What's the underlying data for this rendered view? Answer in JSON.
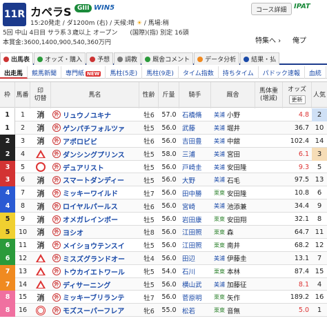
{
  "race": {
    "number": "11R",
    "name": "カペラS",
    "grade": "GIII",
    "win5": "WIN5",
    "info_line1": "15:20発走 / ダ1200m (右) / 天候:晴",
    "info_track": "/ 馬場:稍",
    "info_line2": "5回 中山 4日目 サラ系３歳以上 オープン　　(国際)(指) 別定 16頭",
    "info_line3": "本賞金:3600,1400,900,540,360万円"
  },
  "topbar": {
    "course_detail": "コース詳細",
    "ipat": "IPAT",
    "feature": "特集へ",
    "cancel": "俺プ"
  },
  "tabs": [
    "出馬表",
    "オッズ・購入",
    "予想",
    "調教",
    "厩舎コメント",
    "データ分析",
    "結果・払"
  ],
  "subtabs": [
    "出走馬",
    "競馬新聞",
    "専門紙",
    "馬柱(5走)",
    "馬柱(9走)",
    "タイム指数",
    "持ちタイム",
    "パドック速報",
    "血統"
  ],
  "new_badge": "NEW",
  "headers": {
    "waku": "枠",
    "umaban": "馬番",
    "mark": "印",
    "mark2": "切替",
    "name": "馬名",
    "sexage": "性齢",
    "weight": "斤量",
    "jockey": "騎手",
    "trainer": "厩舎",
    "body_weight": "馬体重",
    "body_diff": "(増減)",
    "odds": "オッズ",
    "refresh": "更新",
    "pop": "人気"
  },
  "entries": [
    {
      "waku": "1",
      "umaban": "1",
      "mark": "消",
      "name": "リュウノユキナ",
      "sexage": "牡6",
      "weight": "57.0",
      "jockey": "石橋脩",
      "stable_region": "美浦",
      "trainer": "小野",
      "odds": "4.8",
      "pop": "2"
    },
    {
      "waku": "1",
      "umaban": "2",
      "mark": "消",
      "name": "ゲンパチフォルツァ",
      "sexage": "牡5",
      "weight": "56.0",
      "jockey": "武藤",
      "stable_region": "美浦",
      "trainer": "堀井",
      "odds": "36.7",
      "pop": "10"
    },
    {
      "waku": "2",
      "umaban": "3",
      "mark": "消",
      "name": "アポロビビ",
      "sexage": "牡6",
      "weight": "56.0",
      "jockey": "吉田豊",
      "stable_region": "美浦",
      "trainer": "中舘",
      "odds": "102.4",
      "pop": "14"
    },
    {
      "waku": "2",
      "umaban": "4",
      "mark": "△",
      "name": "ダンシングプリンス",
      "sexage": "牡5",
      "weight": "58.0",
      "jockey": "三浦",
      "stable_region": "美浦",
      "trainer": "宮田",
      "odds": "6.1",
      "pop": "3"
    },
    {
      "waku": "3",
      "umaban": "5",
      "mark": "◯",
      "name": "デュアリスト",
      "sexage": "牡5",
      "weight": "56.0",
      "jockey": "戸崎圭",
      "stable_region": "美浦",
      "trainer": "安田隆",
      "odds": "9.3",
      "pop": "5"
    },
    {
      "waku": "3",
      "umaban": "6",
      "mark": "消",
      "name": "スマートダンディー",
      "sexage": "牡5",
      "weight": "56.0",
      "jockey": "大野",
      "stable_region": "美浦",
      "trainer": "石毛",
      "odds": "97.5",
      "pop": "13"
    },
    {
      "waku": "4",
      "umaban": "7",
      "mark": "消",
      "name": "ミッキーワイルド",
      "sexage": "牡7",
      "weight": "56.0",
      "jockey": "田中勝",
      "stable_region": "栗東",
      "trainer": "安田隆",
      "odds": "10.8",
      "pop": "6"
    },
    {
      "waku": "4",
      "umaban": "8",
      "mark": "消",
      "name": "ロイヤルパールス",
      "sexage": "牡6",
      "weight": "56.0",
      "jockey": "宮崎",
      "stable_region": "美浦",
      "trainer": "池添兼",
      "odds": "34.4",
      "pop": "9"
    },
    {
      "waku": "5",
      "umaban": "9",
      "mark": "消",
      "name": "オメガレインボー",
      "sexage": "牡5",
      "weight": "56.0",
      "jockey": "岩田康",
      "stable_region": "栗東",
      "trainer": "安田翔",
      "odds": "32.1",
      "pop": "8"
    },
    {
      "waku": "5",
      "umaban": "10",
      "mark": "消",
      "name": "ヨシオ",
      "sexage": "牡8",
      "weight": "56.0",
      "jockey": "江田照",
      "stable_region": "栗東",
      "trainer": "森",
      "odds": "64.7",
      "pop": "11"
    },
    {
      "waku": "6",
      "umaban": "11",
      "mark": "消",
      "name": "メイショウテンスイ",
      "sexage": "牡5",
      "weight": "56.0",
      "jockey": "江田照",
      "stable_region": "栗東",
      "trainer": "南井",
      "odds": "68.2",
      "pop": "12"
    },
    {
      "waku": "6",
      "umaban": "12",
      "mark": "△",
      "name": "ミスズグランドオー",
      "sexage": "牡4",
      "weight": "56.0",
      "jockey": "田辺",
      "stable_region": "美浦",
      "trainer": "伊藤圭",
      "odds": "13.1",
      "pop": "7"
    },
    {
      "waku": "7",
      "umaban": "13",
      "mark": "△",
      "name": "トウカイエトワール",
      "sexage": "牝5",
      "weight": "54.0",
      "jockey": "石川",
      "stable_region": "栗東",
      "trainer": "本林",
      "odds": "87.4",
      "pop": "15"
    },
    {
      "waku": "7",
      "umaban": "14",
      "mark": "△",
      "name": "ディサーニング",
      "sexage": "牡5",
      "weight": "56.0",
      "jockey": "横山武",
      "stable_region": "美浦",
      "trainer": "加藤征",
      "odds": "8.1",
      "pop": "4"
    },
    {
      "waku": "8",
      "umaban": "15",
      "mark": "消",
      "name": "ミッキーブリランテ",
      "sexage": "牡7",
      "weight": "56.0",
      "jockey": "菅原明",
      "stable_region": "栗東",
      "trainer": "矢作",
      "odds": "189.2",
      "pop": "16"
    },
    {
      "waku": "8",
      "umaban": "16",
      "mark": "◎",
      "name": "モズスーパーフレア",
      "sexage": "牝6",
      "weight": "55.0",
      "jockey": "松若",
      "stable_region": "栗東",
      "trainer": "音無",
      "odds": "5.0",
      "pop": "1"
    }
  ],
  "colors": {
    "waku1": "#ffffff",
    "waku2": "#222222",
    "waku3": "#d33333",
    "waku4": "#2a5ad3",
    "waku5": "#f0d030",
    "waku6": "#2a9a3a",
    "waku7": "#f08a20",
    "waku8": "#f070a0",
    "accent": "#1b3a8c"
  }
}
